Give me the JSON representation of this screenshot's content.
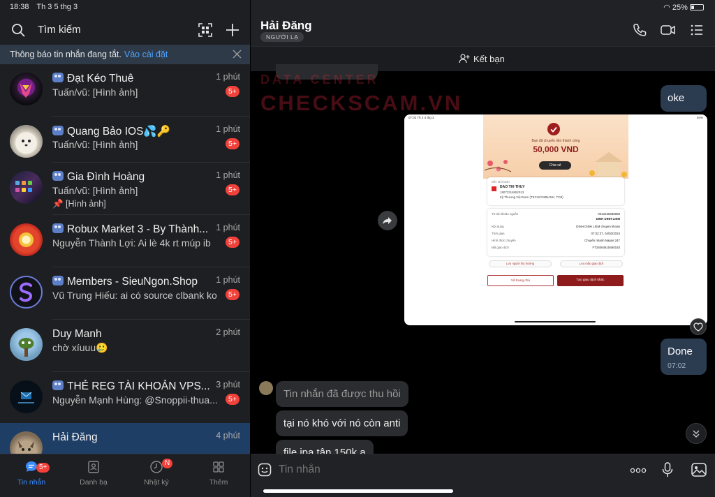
{
  "status": {
    "time": "18:38",
    "date": "Th 3 5 thg 3",
    "battery": "25%"
  },
  "sidebar": {
    "search_label": "Tìm kiếm",
    "notice_text": "Thông báo tin nhắn đang tắt.",
    "notice_link": "Vào cài đặt",
    "chats": [
      {
        "title": "Đạt Kéo Thuê",
        "preview": "Tuấn/vũ: [Hình ảnh]",
        "time": "1 phút",
        "badge": "5+",
        "group": true
      },
      {
        "title": "Quang Bảo IOS💦🔑",
        "preview": "Tuấn/vũ: [Hình ảnh]",
        "time": "1 phút",
        "badge": "5+",
        "group": true
      },
      {
        "title": "Gia Đình Hoàng",
        "preview": "Tuấn/vũ: [Hình ảnh]",
        "preview2": "📌 [Hình ảnh]",
        "time": "1 phút",
        "badge": "5+",
        "group": true
      },
      {
        "title": "Robux Market 3 - By Thành...",
        "preview": "Nguyễn Thành Lợi: Ai lè 4k rt múp ib",
        "time": "1 phút",
        "badge": "5+",
        "group": true
      },
      {
        "title": "Members - SieuNgon.Shop",
        "preview": "Vũ Trung Hiếu: ai có source clbank ko",
        "time": "1 phút",
        "badge": "5+",
        "group": true
      },
      {
        "title": "Duy Manh",
        "preview": "chờ xíuuu🥲",
        "time": "2 phút",
        "badge": "",
        "group": false
      },
      {
        "title": "THẺ REG TÀI KHOẢN VPS...",
        "preview": "Nguyễn Mạnh Hùng: @Snoppii-thua...",
        "time": "3 phút",
        "badge": "5+",
        "group": true
      },
      {
        "title": "Hải Đăng",
        "preview": "",
        "time": "4 phút",
        "badge": "",
        "group": false
      }
    ]
  },
  "nav": {
    "items": [
      {
        "label": "Tin nhắn",
        "badge": "5+"
      },
      {
        "label": "Danh bạ",
        "badge": ""
      },
      {
        "label": "Nhật ký",
        "badge": "N"
      },
      {
        "label": "Thêm",
        "badge": ""
      }
    ]
  },
  "conversation": {
    "contact_name": "Hải Đăng",
    "stranger_tag": "NGƯỜI LẠ",
    "add_friend": "Kết bạn",
    "messages": {
      "oke": "oke",
      "done": "Done",
      "done_time": "07:02",
      "recalled": "Tin nhắn đã được thu hồi",
      "msg1": "tại nó khó với nó còn anti",
      "msg2": "file ipa tận 150k ạ"
    },
    "composer_placeholder": "Tin nhắn"
  },
  "watermark": {
    "line1": "DATA CENTER",
    "line2": "CHECKSCAM.VN"
  },
  "photo": {
    "status_time": "07:02  Th 2 4 thg 3",
    "status_right": "94%",
    "subtitle": "Bạn đã chuyển tiền thành công",
    "amount": "50,000 VND",
    "share": "Chia sẻ",
    "recipient_label": "Đến tài khoản",
    "recipient_name": "DAO THI THUY",
    "recipient_account": "19072316952013",
    "recipient_bank": "Kỹ Thương Việt Nam (TECHCOMBANK, TCB)",
    "rows": [
      {
        "label": "Từ tài khoản nguồn",
        "value": "0012230686868"
      },
      {
        "label": "",
        "value": "DINH DINH LIEM"
      },
      {
        "label": "Nội dung",
        "value": "DINH DINH LIEM chuyen khoan"
      },
      {
        "label": "Thời gian",
        "value": "07:02:37, 04/03/2024"
      },
      {
        "label": "Hình thức chuyển",
        "value": "Chuyển nhanh Napas 247"
      },
      {
        "label": "Mã giao dịch",
        "value": "FT24064615460183"
      }
    ],
    "save_recipient": "Lưu người thụ hưởng",
    "save_template": "Lưu mẫu giao dịch",
    "home_btn": "Về trang chủ",
    "new_btn": "Tạo giao dịch khác"
  },
  "colors": {
    "accent": "#3b8cff",
    "badge": "#f2413b",
    "active_row": "#1f3e66",
    "outgoing_bubble": "#2b3b50"
  }
}
